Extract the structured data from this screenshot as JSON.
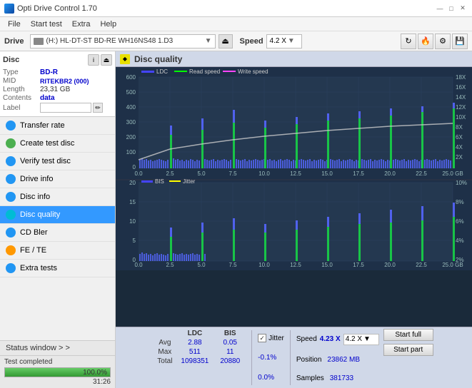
{
  "titleBar": {
    "title": "Opti Drive Control 1.70",
    "minBtn": "—",
    "maxBtn": "□",
    "closeBtn": "✕"
  },
  "menuBar": {
    "items": [
      "File",
      "Start test",
      "Extra",
      "Help"
    ]
  },
  "driveBar": {
    "label": "Drive",
    "driveValue": "(H:)  HL-DT-ST BD-RE  WH16NS48 1.D3",
    "speedLabel": "Speed",
    "speedValue": "4.2 X"
  },
  "disc": {
    "title": "Disc",
    "typeLabel": "Type",
    "typeValue": "BD-R",
    "midLabel": "MID",
    "midValue": "RITEKBR2 (000)",
    "lengthLabel": "Length",
    "lengthValue": "23,31 GB",
    "contentsLabel": "Contents",
    "contentsValue": "data",
    "labelLabel": "Label",
    "labelValue": ""
  },
  "sidebarItems": [
    {
      "id": "transfer-rate",
      "label": "Transfer rate",
      "iconColor": "blue"
    },
    {
      "id": "create-test-disc",
      "label": "Create test disc",
      "iconColor": "green"
    },
    {
      "id": "verify-test-disc",
      "label": "Verify test disc",
      "iconColor": "blue"
    },
    {
      "id": "drive-info",
      "label": "Drive info",
      "iconColor": "blue"
    },
    {
      "id": "disc-info",
      "label": "Disc info",
      "iconColor": "blue"
    },
    {
      "id": "disc-quality",
      "label": "Disc quality",
      "iconColor": "cyan",
      "active": true
    },
    {
      "id": "cd-bler",
      "label": "CD Bler",
      "iconColor": "blue"
    },
    {
      "id": "fe-te",
      "label": "FE / TE",
      "iconColor": "orange"
    },
    {
      "id": "extra-tests",
      "label": "Extra tests",
      "iconColor": "blue"
    }
  ],
  "statusWindow": {
    "label": "Status window > >",
    "statusText": "Test completed",
    "progressPercent": 100,
    "progressLabel": "100.0%",
    "timeLabel": "31:26"
  },
  "chart": {
    "title": "Disc quality",
    "legend": {
      "ldc": "LDC",
      "read": "Read speed",
      "write": "Write speed",
      "bis": "BIS",
      "jitter": "Jitter"
    },
    "topChart": {
      "yAxisLeft": [
        "600",
        "500",
        "400",
        "300",
        "200",
        "100",
        "0"
      ],
      "yAxisRight": [
        "18X",
        "16X",
        "14X",
        "12X",
        "10X",
        "8X",
        "6X",
        "4X",
        "2X"
      ],
      "xAxis": [
        "0.0",
        "2.5",
        "5.0",
        "7.5",
        "10.0",
        "12.5",
        "15.0",
        "17.5",
        "20.0",
        "22.5",
        "25.0 GB"
      ]
    },
    "bottomChart": {
      "yAxisLeft": [
        "20",
        "15",
        "10",
        "5",
        "0"
      ],
      "yAxisRight": [
        "10%",
        "8%",
        "6%",
        "4%",
        "2%"
      ],
      "xAxis": [
        "0.0",
        "2.5",
        "5.0",
        "7.5",
        "10.0",
        "12.5",
        "15.0",
        "17.5",
        "20.0",
        "22.5",
        "25.0 GB"
      ]
    }
  },
  "stats": {
    "columns": [
      "LDC",
      "BIS",
      "",
      "Jitter",
      "Speed",
      "4.23 X"
    ],
    "speedDropdown": "4.2 X",
    "rows": [
      {
        "label": "Avg",
        "ldc": "2.88",
        "bis": "0.05",
        "jitter": "-0.1%",
        "speedLabel": "Position",
        "speedValue": "23862 MB"
      },
      {
        "label": "Max",
        "ldc": "511",
        "bis": "11",
        "jitter": "0.0%",
        "speedLabel": "Samples",
        "speedValue": "381733"
      },
      {
        "label": "Total",
        "ldc": "1098351",
        "bis": "20880",
        "jitter": ""
      }
    ],
    "startFullLabel": "Start full",
    "startPartLabel": "Start part"
  }
}
